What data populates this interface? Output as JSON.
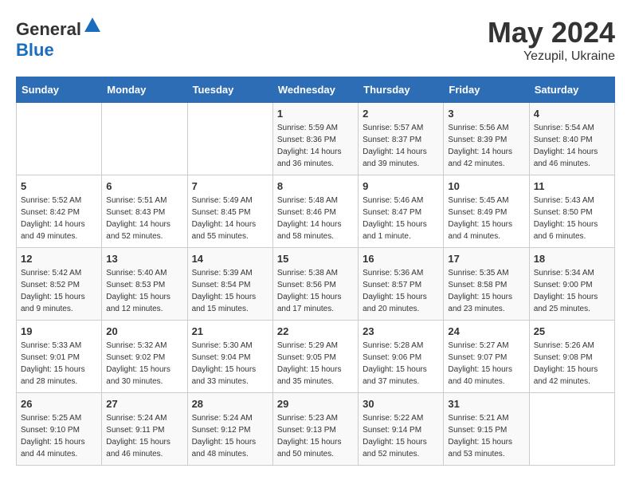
{
  "header": {
    "logo_general": "General",
    "logo_blue": "Blue",
    "month_year": "May 2024",
    "location": "Yezupil, Ukraine"
  },
  "weekdays": [
    "Sunday",
    "Monday",
    "Tuesday",
    "Wednesday",
    "Thursday",
    "Friday",
    "Saturday"
  ],
  "weeks": [
    [
      {
        "day": "",
        "sunrise": "",
        "sunset": "",
        "daylight": ""
      },
      {
        "day": "",
        "sunrise": "",
        "sunset": "",
        "daylight": ""
      },
      {
        "day": "",
        "sunrise": "",
        "sunset": "",
        "daylight": ""
      },
      {
        "day": "1",
        "sunrise": "Sunrise: 5:59 AM",
        "sunset": "Sunset: 8:36 PM",
        "daylight": "Daylight: 14 hours and 36 minutes."
      },
      {
        "day": "2",
        "sunrise": "Sunrise: 5:57 AM",
        "sunset": "Sunset: 8:37 PM",
        "daylight": "Daylight: 14 hours and 39 minutes."
      },
      {
        "day": "3",
        "sunrise": "Sunrise: 5:56 AM",
        "sunset": "Sunset: 8:39 PM",
        "daylight": "Daylight: 14 hours and 42 minutes."
      },
      {
        "day": "4",
        "sunrise": "Sunrise: 5:54 AM",
        "sunset": "Sunset: 8:40 PM",
        "daylight": "Daylight: 14 hours and 46 minutes."
      }
    ],
    [
      {
        "day": "5",
        "sunrise": "Sunrise: 5:52 AM",
        "sunset": "Sunset: 8:42 PM",
        "daylight": "Daylight: 14 hours and 49 minutes."
      },
      {
        "day": "6",
        "sunrise": "Sunrise: 5:51 AM",
        "sunset": "Sunset: 8:43 PM",
        "daylight": "Daylight: 14 hours and 52 minutes."
      },
      {
        "day": "7",
        "sunrise": "Sunrise: 5:49 AM",
        "sunset": "Sunset: 8:45 PM",
        "daylight": "Daylight: 14 hours and 55 minutes."
      },
      {
        "day": "8",
        "sunrise": "Sunrise: 5:48 AM",
        "sunset": "Sunset: 8:46 PM",
        "daylight": "Daylight: 14 hours and 58 minutes."
      },
      {
        "day": "9",
        "sunrise": "Sunrise: 5:46 AM",
        "sunset": "Sunset: 8:47 PM",
        "daylight": "Daylight: 15 hours and 1 minute."
      },
      {
        "day": "10",
        "sunrise": "Sunrise: 5:45 AM",
        "sunset": "Sunset: 8:49 PM",
        "daylight": "Daylight: 15 hours and 4 minutes."
      },
      {
        "day": "11",
        "sunrise": "Sunrise: 5:43 AM",
        "sunset": "Sunset: 8:50 PM",
        "daylight": "Daylight: 15 hours and 6 minutes."
      }
    ],
    [
      {
        "day": "12",
        "sunrise": "Sunrise: 5:42 AM",
        "sunset": "Sunset: 8:52 PM",
        "daylight": "Daylight: 15 hours and 9 minutes."
      },
      {
        "day": "13",
        "sunrise": "Sunrise: 5:40 AM",
        "sunset": "Sunset: 8:53 PM",
        "daylight": "Daylight: 15 hours and 12 minutes."
      },
      {
        "day": "14",
        "sunrise": "Sunrise: 5:39 AM",
        "sunset": "Sunset: 8:54 PM",
        "daylight": "Daylight: 15 hours and 15 minutes."
      },
      {
        "day": "15",
        "sunrise": "Sunrise: 5:38 AM",
        "sunset": "Sunset: 8:56 PM",
        "daylight": "Daylight: 15 hours and 17 minutes."
      },
      {
        "day": "16",
        "sunrise": "Sunrise: 5:36 AM",
        "sunset": "Sunset: 8:57 PM",
        "daylight": "Daylight: 15 hours and 20 minutes."
      },
      {
        "day": "17",
        "sunrise": "Sunrise: 5:35 AM",
        "sunset": "Sunset: 8:58 PM",
        "daylight": "Daylight: 15 hours and 23 minutes."
      },
      {
        "day": "18",
        "sunrise": "Sunrise: 5:34 AM",
        "sunset": "Sunset: 9:00 PM",
        "daylight": "Daylight: 15 hours and 25 minutes."
      }
    ],
    [
      {
        "day": "19",
        "sunrise": "Sunrise: 5:33 AM",
        "sunset": "Sunset: 9:01 PM",
        "daylight": "Daylight: 15 hours and 28 minutes."
      },
      {
        "day": "20",
        "sunrise": "Sunrise: 5:32 AM",
        "sunset": "Sunset: 9:02 PM",
        "daylight": "Daylight: 15 hours and 30 minutes."
      },
      {
        "day": "21",
        "sunrise": "Sunrise: 5:30 AM",
        "sunset": "Sunset: 9:04 PM",
        "daylight": "Daylight: 15 hours and 33 minutes."
      },
      {
        "day": "22",
        "sunrise": "Sunrise: 5:29 AM",
        "sunset": "Sunset: 9:05 PM",
        "daylight": "Daylight: 15 hours and 35 minutes."
      },
      {
        "day": "23",
        "sunrise": "Sunrise: 5:28 AM",
        "sunset": "Sunset: 9:06 PM",
        "daylight": "Daylight: 15 hours and 37 minutes."
      },
      {
        "day": "24",
        "sunrise": "Sunrise: 5:27 AM",
        "sunset": "Sunset: 9:07 PM",
        "daylight": "Daylight: 15 hours and 40 minutes."
      },
      {
        "day": "25",
        "sunrise": "Sunrise: 5:26 AM",
        "sunset": "Sunset: 9:08 PM",
        "daylight": "Daylight: 15 hours and 42 minutes."
      }
    ],
    [
      {
        "day": "26",
        "sunrise": "Sunrise: 5:25 AM",
        "sunset": "Sunset: 9:10 PM",
        "daylight": "Daylight: 15 hours and 44 minutes."
      },
      {
        "day": "27",
        "sunrise": "Sunrise: 5:24 AM",
        "sunset": "Sunset: 9:11 PM",
        "daylight": "Daylight: 15 hours and 46 minutes."
      },
      {
        "day": "28",
        "sunrise": "Sunrise: 5:24 AM",
        "sunset": "Sunset: 9:12 PM",
        "daylight": "Daylight: 15 hours and 48 minutes."
      },
      {
        "day": "29",
        "sunrise": "Sunrise: 5:23 AM",
        "sunset": "Sunset: 9:13 PM",
        "daylight": "Daylight: 15 hours and 50 minutes."
      },
      {
        "day": "30",
        "sunrise": "Sunrise: 5:22 AM",
        "sunset": "Sunset: 9:14 PM",
        "daylight": "Daylight: 15 hours and 52 minutes."
      },
      {
        "day": "31",
        "sunrise": "Sunrise: 5:21 AM",
        "sunset": "Sunset: 9:15 PM",
        "daylight": "Daylight: 15 hours and 53 minutes."
      },
      {
        "day": "",
        "sunrise": "",
        "sunset": "",
        "daylight": ""
      }
    ]
  ]
}
